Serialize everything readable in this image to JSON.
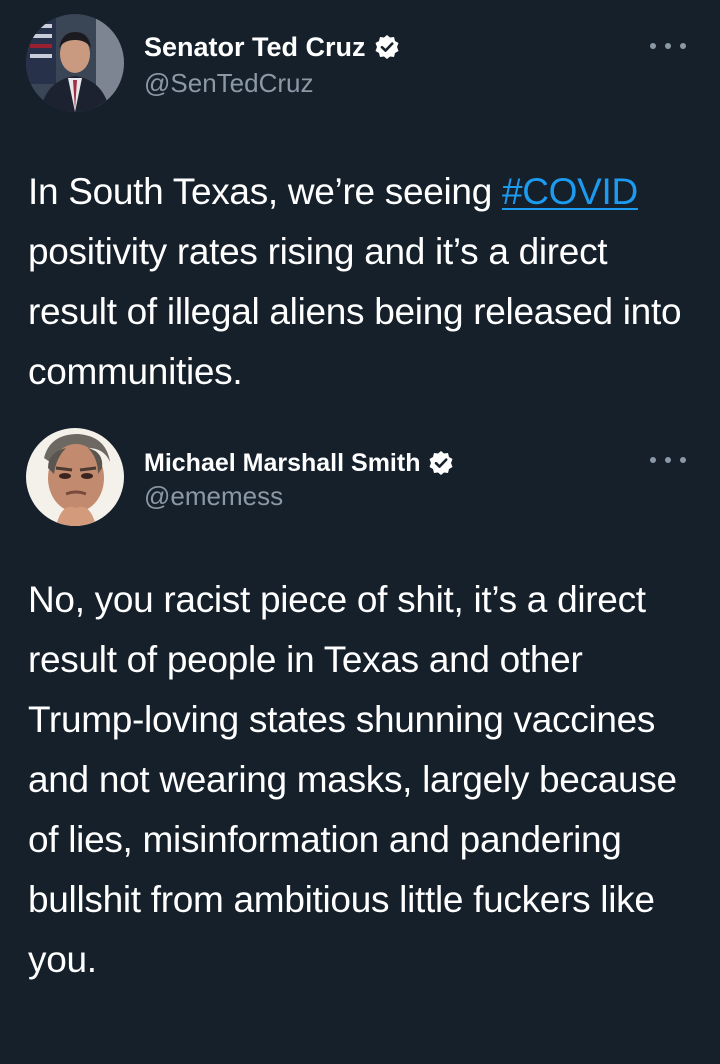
{
  "tweets": [
    {
      "author": {
        "display_name": "Senator Ted Cruz",
        "handle": "@SenTedCruz",
        "verified": true,
        "verified_icon": "verified-badge-icon"
      },
      "text_before": "In South Texas, we’re seeing ",
      "hashtag": "#COVID",
      "text_after": " positivity rates rising and it’s a direct result of illegal aliens being released into communities.",
      "more_icon": "more-options-icon"
    },
    {
      "author": {
        "display_name": "Michael Marshall Smith",
        "handle": "@ememess",
        "verified": true,
        "verified_icon": "verified-badge-icon"
      },
      "text": "No, you racist piece of shit, it’s a direct result of people in Texas and other Trump-loving states shunning vaccines and not wearing masks, largely because of lies, misinformation and pandering bullshit from ambitious little fuckers like you.",
      "more_icon": "more-options-icon"
    }
  ],
  "colors": {
    "background": "#15202b",
    "text": "#ffffff",
    "secondary_text": "#8b98a5",
    "link": "#1d9bf0"
  }
}
